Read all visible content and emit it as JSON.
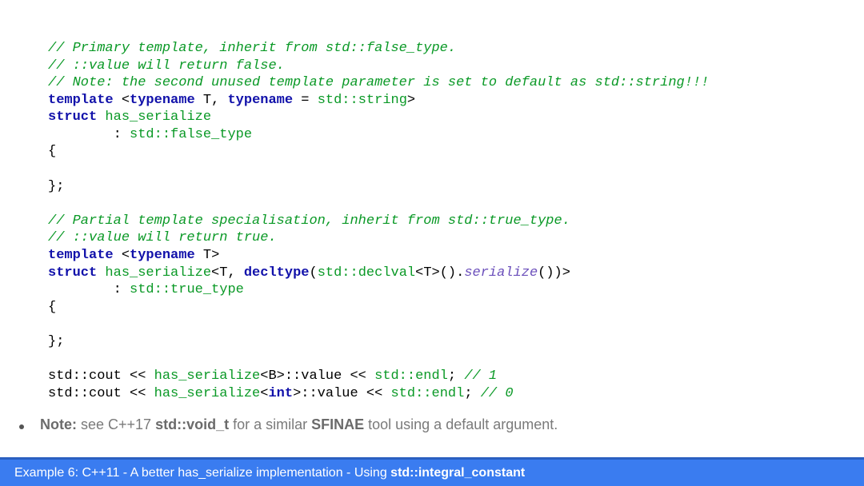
{
  "code": {
    "c1": "// Primary template, inherit from std::false_type.",
    "c2": "// ::value will return false.",
    "c3": "// Note: the second unused template parameter is set to default as std::string!!!",
    "kw_template": "template",
    "kw_typename": "typename",
    "kw_struct": "struct",
    "kw_decltype": "decltype",
    "kw_int": "int",
    "tparam_T": " T",
    "eq_space": " = ",
    "std_string": "std::string",
    "angle_open": " <",
    "angle_close": ">",
    "comma_space": ", ",
    "has_serialize": " has_serialize",
    "has_serialize_plain": "has_serialize",
    "colon_indent": "        : ",
    "std_false_type": "std::false_type",
    "std_true_type": "std::true_type",
    "brace_open": "{",
    "brace_close": "};",
    "c4": "// Partial template specialisation, inherit from std::true_type.",
    "c5": "// ::value will return true.",
    "spec_open": "<",
    "T": "T",
    "std_declval": "std::declval",
    "declval_call": "().",
    "serialize": "serialize",
    "serialize_call": "())>",
    "decltype_open": "(",
    "cout": "std::cout << ",
    "value_B": "<B>::value << ",
    "value_int_pre": "<",
    "value_int_post": ">::value << ",
    "endl": "std::endl",
    "semi_1": "; ",
    "semi_only": ";",
    "comment_1": "// 1",
    "comment_0": "// 0"
  },
  "note": {
    "prefix": "Note:",
    "t1": " see C++17 ",
    "b1": "std::void_t",
    "t2": " for a similar ",
    "b2": "SFINAE",
    "t3": " tool using a default argument."
  },
  "footer": {
    "t1": "Example 6: C++11 - A better has_serialize implementation - Using ",
    "b1": "std::integral_constant"
  }
}
